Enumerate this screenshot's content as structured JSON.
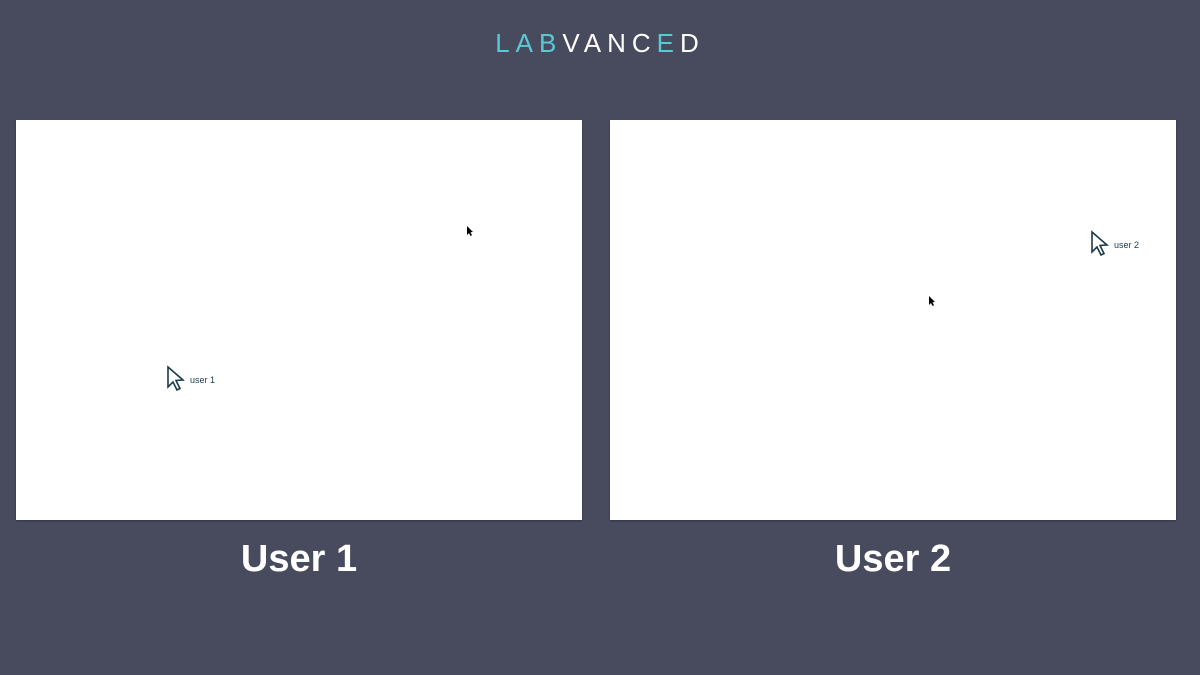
{
  "logo": {
    "part1": "LAB",
    "part2": "VANC",
    "part3": "ED"
  },
  "panels": {
    "left": {
      "label": "User 1",
      "bigCursor": {
        "label": "user 1"
      }
    },
    "right": {
      "label": "User 2",
      "bigCursor": {
        "label": "user 2"
      }
    }
  }
}
